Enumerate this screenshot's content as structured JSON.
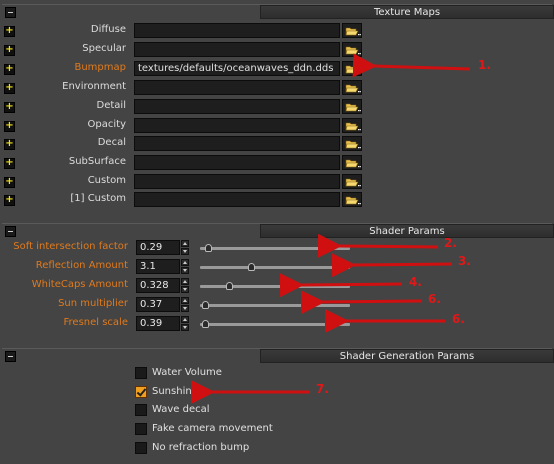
{
  "texture_maps": {
    "title": "Texture Maps",
    "rows": [
      {
        "label": "Diffuse",
        "value": "",
        "highlight": false
      },
      {
        "label": "Specular",
        "value": "",
        "highlight": false
      },
      {
        "label": "Bumpmap",
        "value": "textures/defaults/oceanwaves_ddn.dds",
        "highlight": true
      },
      {
        "label": "Environment",
        "value": "",
        "highlight": false
      },
      {
        "label": "Detail",
        "value": "",
        "highlight": false
      },
      {
        "label": "Opacity",
        "value": "",
        "highlight": false
      },
      {
        "label": "Decal",
        "value": "",
        "highlight": false
      },
      {
        "label": "SubSurface",
        "value": "",
        "highlight": false
      },
      {
        "label": "Custom",
        "value": "",
        "highlight": false
      },
      {
        "label": "[1] Custom",
        "value": "",
        "highlight": false
      }
    ]
  },
  "shader_params": {
    "title": "Shader Params",
    "rows": [
      {
        "label": "Soft intersection factor",
        "value": "0.29",
        "slider": 0.05
      },
      {
        "label": "Reflection Amount",
        "value": "3.1",
        "slider": 0.34
      },
      {
        "label": "WhiteCaps Amount",
        "value": "0.328",
        "slider": 0.19
      },
      {
        "label": "Sun multiplier",
        "value": "0.37",
        "slider": 0.03
      },
      {
        "label": "Fresnel scale",
        "value": "0.39",
        "slider": 0.03
      }
    ]
  },
  "shader_generation_params": {
    "title": "Shader Generation Params",
    "rows": [
      {
        "label": "Water Volume",
        "checked": false
      },
      {
        "label": "Sunshine",
        "checked": true
      },
      {
        "label": "Wave decal",
        "checked": false
      },
      {
        "label": "Fake camera movement",
        "checked": false
      },
      {
        "label": "No refraction bump",
        "checked": false
      }
    ]
  },
  "annotations": [
    "1.",
    "2.",
    "3.",
    "4.",
    "6.",
    "6.",
    "7."
  ],
  "colors": {
    "accent_label": "#e07a1c",
    "annotation": "#e01818",
    "background": "#444444"
  },
  "icons": {
    "expand": "plus-icon",
    "browse": "folder-icon",
    "collapse": "minus-icon"
  }
}
